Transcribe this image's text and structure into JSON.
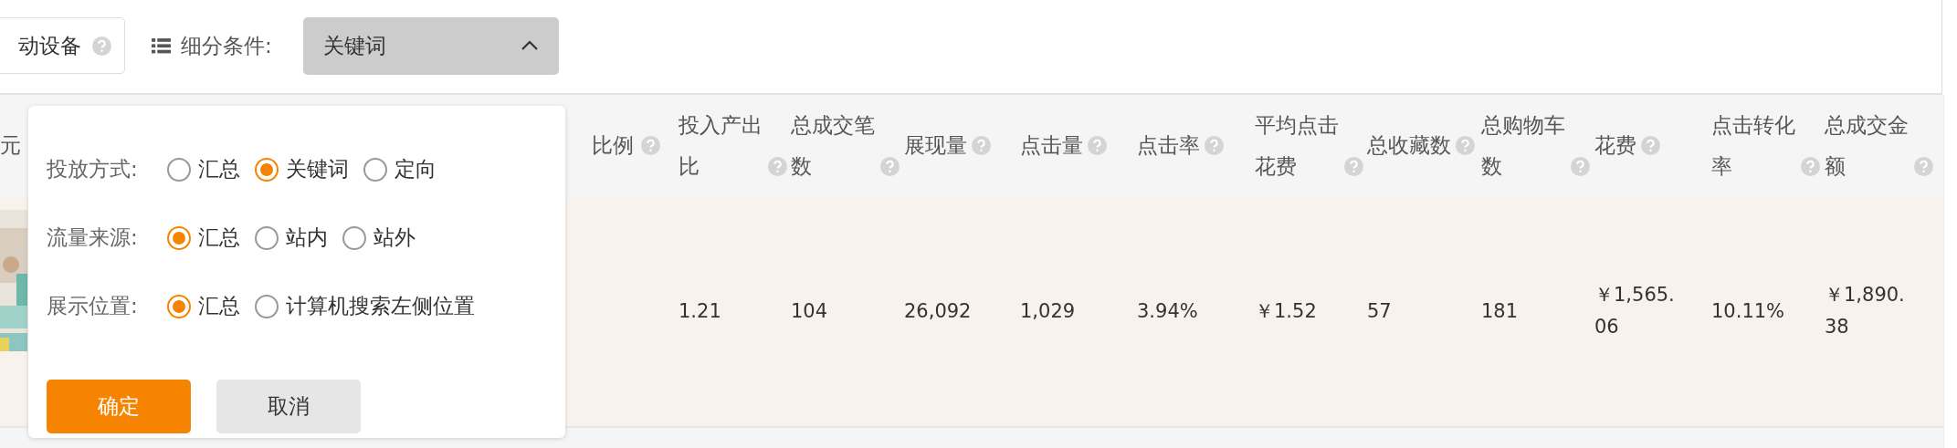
{
  "filter_bar": {
    "device_button": {
      "label": "动设备"
    },
    "segment_label": "细分条件:",
    "segment_dropdown": {
      "value": "关键词",
      "expanded": true
    }
  },
  "table": {
    "columns": [
      {
        "label": "元"
      },
      {
        "label": "比例"
      },
      {
        "label": "投入产出比"
      },
      {
        "label": "总成交笔数"
      },
      {
        "label": "展现量"
      },
      {
        "label": "点击量"
      },
      {
        "label": "点击率"
      },
      {
        "label": "平均点击花费"
      },
      {
        "label": "总收藏数"
      },
      {
        "label": "总购物车数"
      },
      {
        "label": "花费"
      },
      {
        "label": "点击转化率"
      },
      {
        "label": "总成交金额"
      }
    ],
    "rows": [
      {
        "cells": [
          "",
          "",
          "1.21",
          "104",
          "26,092",
          "1,029",
          "3.94%",
          "￥1.52",
          "57",
          "181",
          "￥1,565.06",
          "10.11%",
          "￥1,890.38"
        ]
      }
    ]
  },
  "popup": {
    "groups": [
      {
        "label": "投放方式:",
        "options": [
          {
            "label": "汇总",
            "selected": false
          },
          {
            "label": "关键词",
            "selected": true
          },
          {
            "label": "定向",
            "selected": false
          }
        ]
      },
      {
        "label": "流量来源:",
        "options": [
          {
            "label": "汇总",
            "selected": true
          },
          {
            "label": "站内",
            "selected": false
          },
          {
            "label": "站外",
            "selected": false
          }
        ]
      },
      {
        "label": "展示位置:",
        "options": [
          {
            "label": "汇总",
            "selected": true
          },
          {
            "label": "计算机搜索左侧位置",
            "selected": false
          }
        ]
      }
    ],
    "buttons": [
      {
        "label": "确定",
        "kind": "primary"
      },
      {
        "label": "取消",
        "kind": "secondary"
      }
    ]
  }
}
